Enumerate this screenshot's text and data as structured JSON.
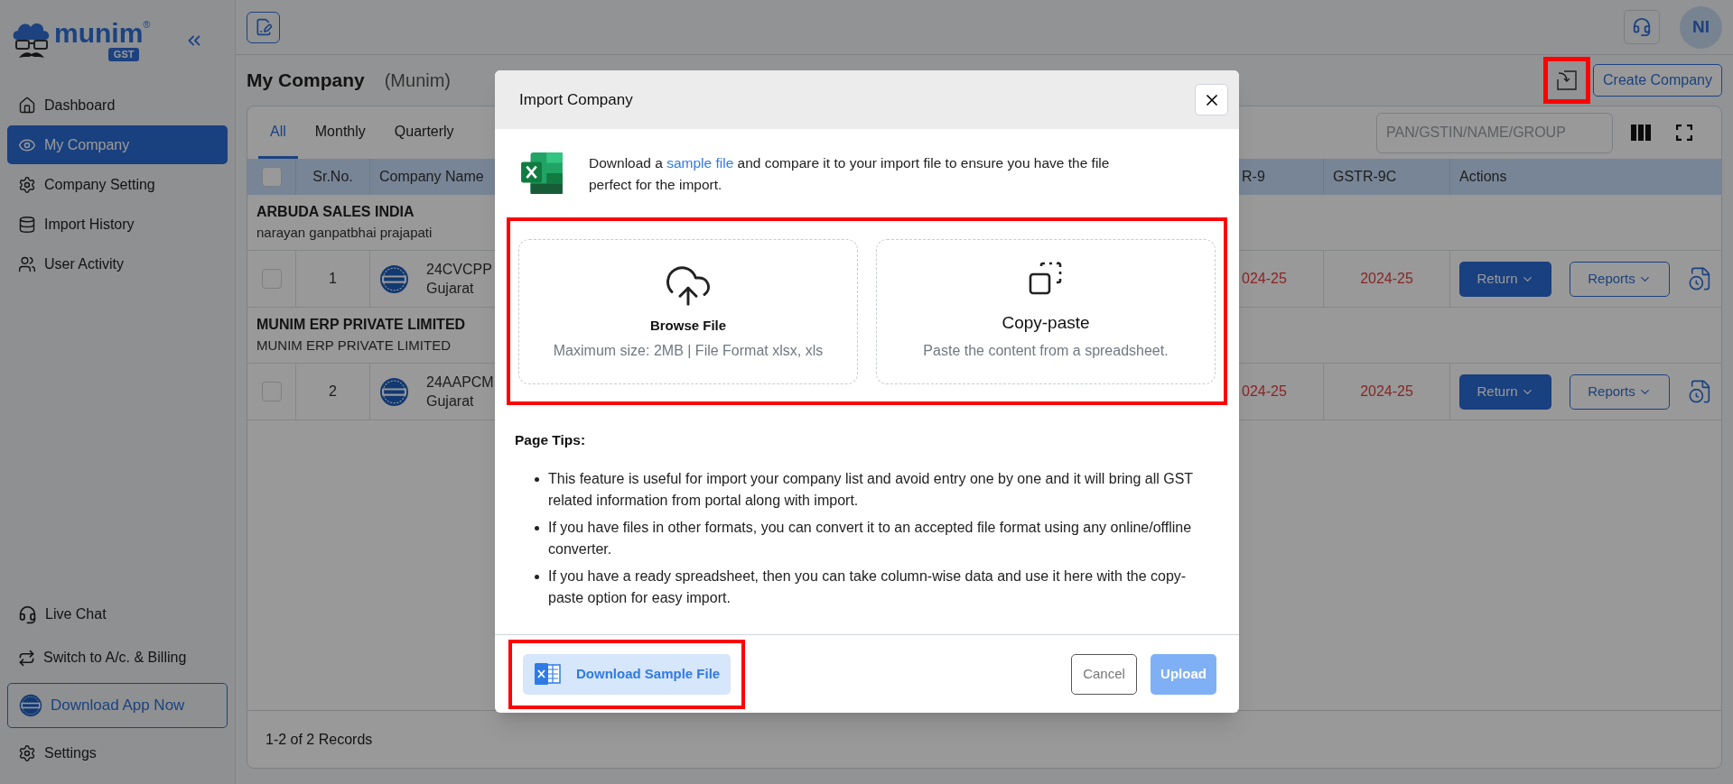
{
  "sidebar": {
    "logo": {
      "wordmark": "munim",
      "registered": "®",
      "badge": "GST"
    },
    "items": [
      {
        "label": "Dashboard",
        "selected": false
      },
      {
        "label": "My Company",
        "selected": true
      },
      {
        "label": "Company Setting",
        "selected": false
      },
      {
        "label": "Import History",
        "selected": false
      },
      {
        "label": "User Activity",
        "selected": false
      }
    ],
    "footer_items": [
      {
        "label": "Live Chat",
        "kind": "link"
      },
      {
        "label": "Switch to A/c. & Billing",
        "kind": "link"
      },
      {
        "label": "Download App Now",
        "kind": "button"
      },
      {
        "label": "Settings",
        "kind": "link"
      }
    ]
  },
  "topbar": {
    "avatar": "NI"
  },
  "page": {
    "title": "My Company",
    "subtitle": "(Munim)",
    "create_button": "Create Company"
  },
  "table": {
    "tabs": [
      {
        "label": "All",
        "selected": true
      },
      {
        "label": "Monthly",
        "selected": false
      },
      {
        "label": "Quarterly",
        "selected": false
      }
    ],
    "search": {
      "placeholder": "PAN/GSTIN/NAME/GROUP"
    },
    "header_checked": false,
    "columns": [
      "Sr.No.",
      "Company Name",
      "R-9",
      "GSTR-9C",
      "Actions"
    ],
    "groups": [
      {
        "name": "ARBUDA SALES INDIA",
        "owner": "narayan ganpatbhai prajapati",
        "rows": [
          {
            "checked": false,
            "sr": "1",
            "gstin": "24CVCPP",
            "state": "Gujarat",
            "column_r9": "024-25",
            "gstr_9c": "2024-25",
            "return_button": "Return",
            "reports_button": "Reports"
          }
        ]
      },
      {
        "name": "MUNIM ERP PRIVATE LIMITED",
        "owner": "MUNIM ERP PRIVATE LIMITED",
        "rows": [
          {
            "checked": false,
            "sr": "2",
            "gstin": "24AAPCM",
            "state": "Gujarat",
            "column_r9": "024-25",
            "gstr_9c": "2024-25",
            "return_button": "Return",
            "reports_button": "Reports"
          }
        ]
      }
    ],
    "footer": "1-2 of 2 Records"
  },
  "modal": {
    "title": "Import Company",
    "intro_before": "Download a",
    "intro_link": "sample file",
    "intro_after": "and compare it to your import file to ensure you have the file perfect for the import.",
    "options": [
      {
        "kind": "browse",
        "title": "Browse File",
        "hint": "Maximum size: 2MB | File Format xlsx, xls"
      },
      {
        "kind": "paste",
        "title": "Copy-paste",
        "hint": "Paste the content from a spreadsheet."
      }
    ],
    "tips_title": "Page Tips:",
    "tips": [
      "This feature is useful for import your company list and avoid entry one by one and it will bring all GST related information from portal along with import.",
      "If you have files in other formats, you can convert it to an accepted file format using any online/offline converter.",
      "If you have a ready spreadsheet, then you can take column-wise data and use it here with the copy-paste option for easy import."
    ],
    "download_button": "Download Sample File",
    "cancel_button": "Cancel",
    "upload_button": {
      "label": "Upload",
      "disabled": true
    }
  }
}
